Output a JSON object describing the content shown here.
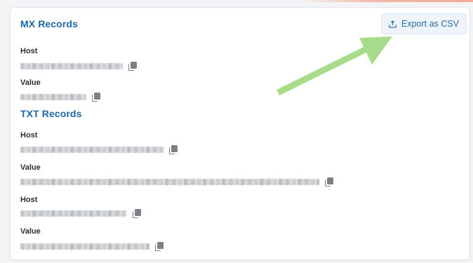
{
  "mx": {
    "title": "MX Records",
    "host_label": "Host",
    "value_label": "Value"
  },
  "txt": {
    "title": "TXT Records",
    "host_label": "Host",
    "value_label": "Value",
    "host2_label": "Host",
    "value2_label": "Value"
  },
  "export": {
    "label": "Export as CSV",
    "icon": "export-icon"
  },
  "icons": {
    "copy": "copy-icon",
    "arrow": "annotation-arrow"
  },
  "colors": {
    "accent": "#2168a6",
    "arrow": "#a9dc8a",
    "button_bg": "#eef4fa"
  }
}
